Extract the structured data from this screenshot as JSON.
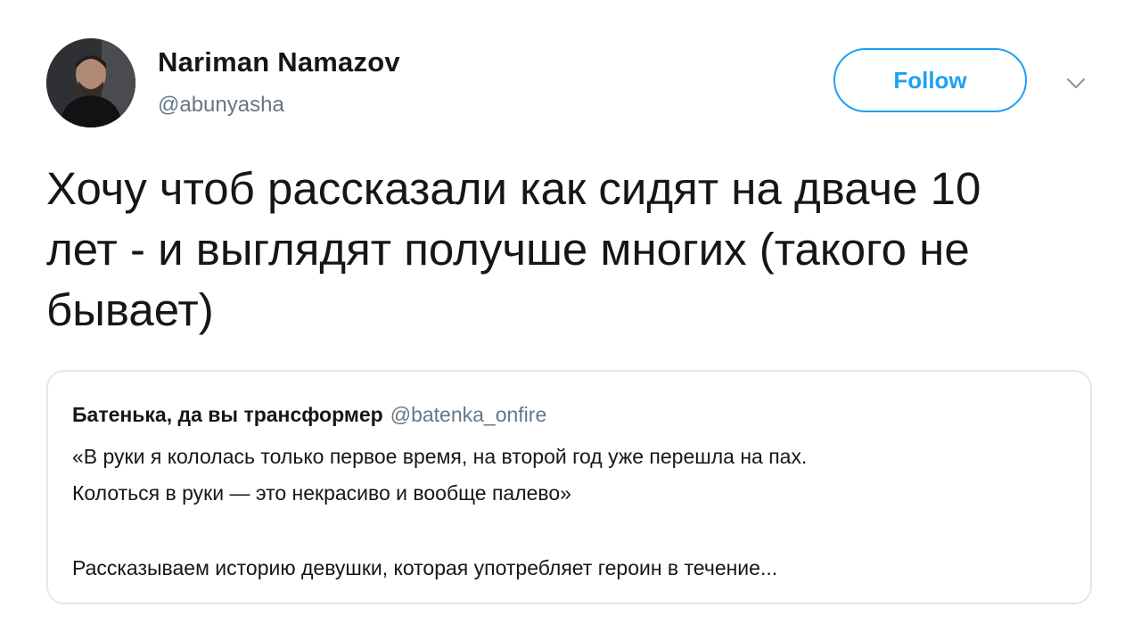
{
  "author": {
    "display_name": "Nariman Namazov",
    "handle": "@abunyasha"
  },
  "actions": {
    "follow_label": "Follow",
    "more_icon": "chevron-down-icon"
  },
  "tweet": {
    "text_lines": [
      "Хочу чтоб рассказали как сидят на дваче 10",
      "лет - и выглядят получше многих (такого не",
      "бывает)"
    ]
  },
  "quote": {
    "author_name": "Батенька, да вы трансформер",
    "author_handle": "@batenka_onfire",
    "lines": [
      "«В руки я кололась только первое время, на второй год уже перешла на пах.",
      "Колоться в руки — это некрасиво и вообще палево»",
      "Рассказываем историю девушки, которая употребляет героин в течение..."
    ]
  },
  "colors": {
    "accent": "#1da1f2",
    "secondary_text": "#657786",
    "border": "#e1e8ed",
    "text": "#14171a"
  }
}
